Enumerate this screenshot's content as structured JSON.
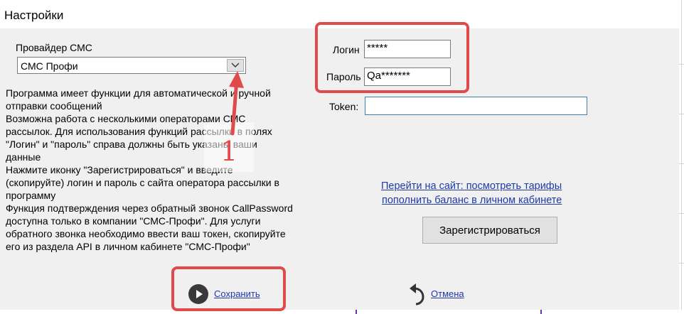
{
  "window": {
    "title": "Настройки"
  },
  "provider": {
    "label": "Провайдер СМС",
    "selected": "СМС Профи"
  },
  "description": [
    "Программа имеет функции для автоматической и ручной",
    "отправки сообщений",
    "Возможна работа с несколькими операторами СМС",
    "рассылок. Для использования функций рассылки в полях",
    "\"Логин\" и \"пароль\" справа должны быть указаны ваши",
    "данные",
    "Нажмите иконку \"Зарегистрироваться\" и введите",
    "(скопируйте) логин и пароль с сайта оператора рассылки в",
    "программу",
    "Функция подтверждения через обратный звонок CallPassword",
    "доступна только в компании \"СМС-Профи\". Для услуги",
    "обратного звонка необходимо ввести ваш токен, скопируйте",
    "его из раздела API в личном кабинете \"СМС-Профи\""
  ],
  "credentials": {
    "login_label": "Логин",
    "login_value": "*****",
    "password_label": "Пароль",
    "password_value": "Qa*******",
    "token_label": "Token:",
    "token_value": ""
  },
  "links": {
    "site": "Перейти на сайт: посмотреть тарифы",
    "balance": "пополнить баланс в личном кабинете"
  },
  "register_button": "Зарегистрироваться",
  "footer": {
    "save_label": "Сохранить",
    "cancel_label": "Отмена"
  },
  "annotation": {
    "number": "1",
    "color": "#e04a4a"
  }
}
